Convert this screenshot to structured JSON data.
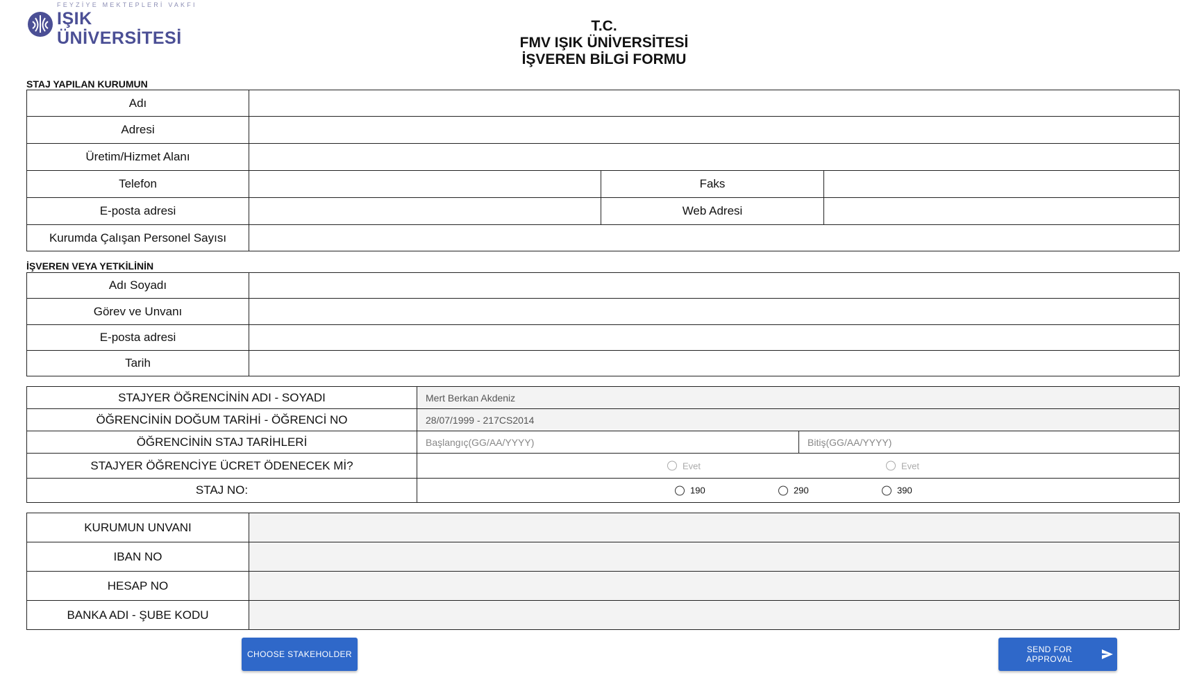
{
  "logo": {
    "top_text": "FEYZİYE MEKTEPLERİ VAKFI",
    "main_text": "IŞIK ÜNİVERSİTESİ"
  },
  "header": {
    "line1": "T.C.",
    "line2": "FMV IŞIK ÜNİVERSİTESİ",
    "line3": "İŞVEREN BİLGİ FORMU"
  },
  "institution": {
    "section_label": "STAJ YAPILAN KURUMUN",
    "name_label": "Adı",
    "address_label": "Adresi",
    "sector_label": "Üretim/Hizmet Alanı",
    "phone_label": "Telefon",
    "fax_label": "Faks",
    "email_label": "E-posta adresi",
    "web_label": "Web Adresi",
    "staff_label": "Kurumda Çalışan Personel Sayısı"
  },
  "employer": {
    "section_label": "İŞVEREN VEYA YETKİLİNİN",
    "name_label": "Adı Soyadı",
    "title_label": "Görev ve Unvanı",
    "email_label": "E-posta adresi",
    "date_label": "Tarih"
  },
  "student": {
    "name_label": "STAJYER ÖĞRENCİNİN ADI - SOYADI",
    "name_value": "Mert Berkan Akdeniz",
    "birth_label": "ÖĞRENCİNİN DOĞUM TARİHİ - ÖĞRENCİ NO",
    "birth_value": "28/07/1999 - 217CS2014",
    "dates_label": "ÖĞRENCİNİN STAJ TARİHLERİ",
    "start_placeholder": "Başlangıç(GG/AA/YYYY)",
    "end_placeholder": "Bitiş(GG/AA/YYYY)",
    "pay_label": "STAJYER ÖĞRENCİYE ÜCRET ÖDENECEK Mİ?",
    "pay_options": [
      "Evet",
      "Evet"
    ],
    "staj_no_label": "STAJ NO:",
    "staj_no_options": [
      "190",
      "290",
      "390"
    ]
  },
  "bank": {
    "title_label": "KURUMUN UNVANI",
    "iban_label": "IBAN NO",
    "account_label": "HESAP NO",
    "bank_label": "BANKA ADI - ŞUBE KODU"
  },
  "buttons": {
    "choose": "CHOOSE STAKEHOLDER",
    "send": "SEND FOR APPROVAL"
  },
  "colors": {
    "button": "#2f68c9",
    "logo": "#4b4f95",
    "gray_field": "#f3f3f3"
  },
  "icons": [
    "university-logo-icon",
    "send-icon"
  ]
}
